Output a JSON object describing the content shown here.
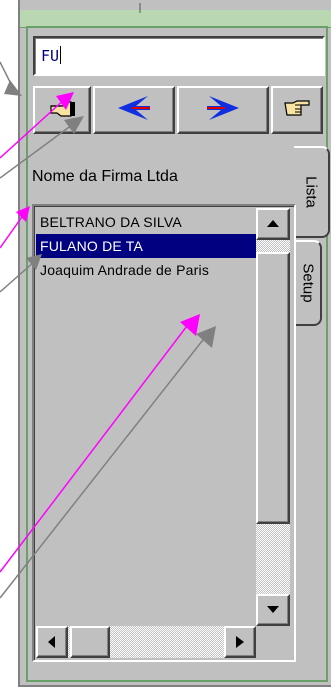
{
  "search": {
    "value": "FU"
  },
  "toolbar": {
    "hand_left_icon": "pointing-hand-left-icon",
    "prev_icon": "blue-arrow-left-icon",
    "next_icon": "blue-arrow-right-icon",
    "hand_right_icon": "pointing-hand-right-icon"
  },
  "firm_name": "Nome da Firma Ltda",
  "tabs": [
    {
      "label": "Lista"
    },
    {
      "label": "Setup"
    }
  ],
  "list": {
    "items": [
      {
        "label": "BELTRANO DA SILVA",
        "selected": false
      },
      {
        "label": "FULANO DE TA",
        "selected": true
      },
      {
        "label": "Joaquim Andrade de Paris",
        "selected": false
      }
    ]
  },
  "colors": {
    "selection": "#000080",
    "arrow_blue": "#1030e0",
    "annotation_magenta": "#ff00ff",
    "annotation_gray": "#808080",
    "frame_green": "#6aa06a"
  }
}
